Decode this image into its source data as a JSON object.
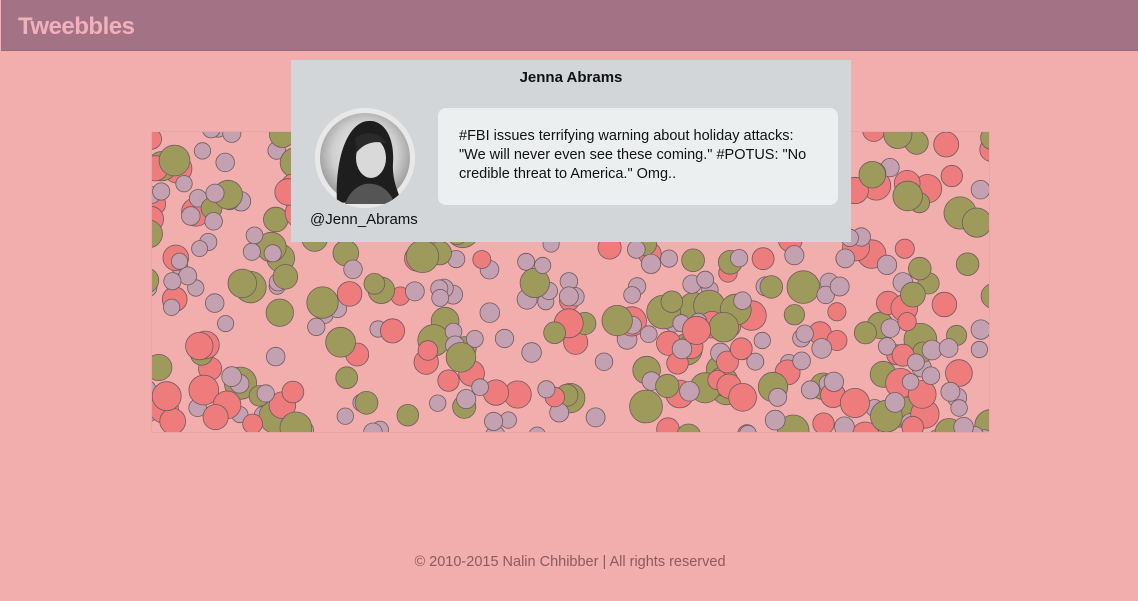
{
  "brand": "Tweebbles",
  "tooltip": {
    "name": "Jenna Abrams",
    "handle": "@Jenn_Abrams",
    "tweet": "#FBI issues terrifying warning about holiday attacks: \"We will never even see these coming.\" #POTUS: \"No credible threat to America.\" Omg.."
  },
  "footer": "© 2010-2015 Nalin Chhibber | All rights reserved",
  "colors": {
    "background": "#f2adad",
    "navbar": "#a37285",
    "bubble_red": "#ee7c7c",
    "bubble_olive": "#9e9a5c",
    "bubble_mauve": "#c4a1b1"
  },
  "icons": {
    "avatar": "profile-photo"
  }
}
